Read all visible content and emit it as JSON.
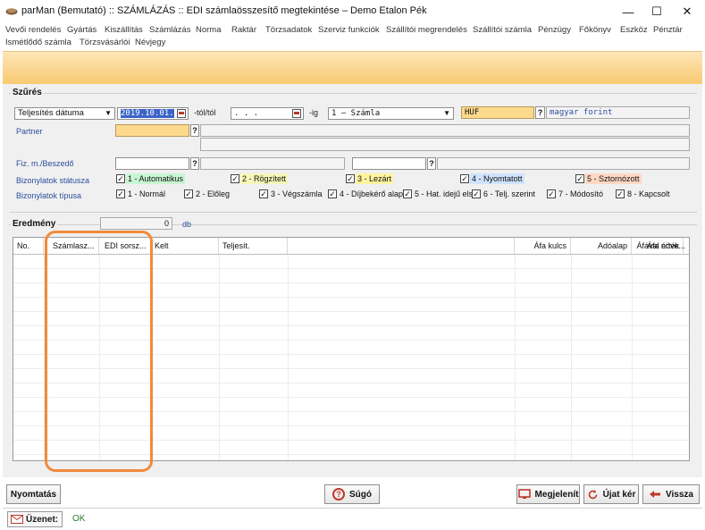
{
  "window": {
    "title": "parMan (Bemutató) :: SZÁMLÁZÁS :: EDI számlaösszesítő megtekintése   –   Demo Etalon Pék",
    "minimize": "—",
    "maximize": "☐",
    "close": "✕"
  },
  "menu": {
    "row1": [
      "Vevői rendelés",
      "Gyártás",
      "Kiszállítás",
      "Számlázás",
      "Norma",
      "Raktár",
      "Törzsadatok",
      "Szerviz funkciók",
      "Szállítói megrendelés",
      "Szállítói számla",
      "Pénzügy",
      "Főkönyv",
      "Eszköz",
      "Pénztár"
    ],
    "row2": [
      "Ismétlődő számla",
      "Törzsvásárlói",
      "Névjegy"
    ]
  },
  "filter": {
    "legend": "Szűrés",
    "date_type": "Teljesítés dátuma",
    "date_from": "2019.10.01.",
    "from_label": "-tól/tól",
    "date_to": "    .  .  .",
    "to_label": "-ig",
    "doc_type": "1 – Számla",
    "currency_code": "HUF",
    "currency_q": "?",
    "currency_name": "magyar forint",
    "partner_label": "Partner",
    "partner_q": "?",
    "payment_label": "Fiz. m./Beszedő",
    "payment_q": "?",
    "payment2_q": "?",
    "status_label": "Bizonylatok státusza",
    "type_label": "Bizonylatok típusa",
    "statuses": [
      {
        "label": "1 - Automatikus",
        "color": "#c8f5d2",
        "checked": "✓"
      },
      {
        "label": "2 - Rögzített",
        "color": "#f7f7b8",
        "checked": "✓"
      },
      {
        "label": "3 - Lezárt",
        "color": "#fff3a0",
        "checked": "✓"
      },
      {
        "label": "4 - Nyomtatott",
        "color": "#cfe3ff",
        "checked": "✓"
      },
      {
        "label": "5 - Sztornózott",
        "color": "#ffd8c4",
        "checked": "✓"
      }
    ],
    "types": [
      {
        "label": "1 - Normál",
        "checked": "✓"
      },
      {
        "label": "2 - Előleg",
        "checked": "✓"
      },
      {
        "label": "3 - Végszámla",
        "checked": "✓"
      },
      {
        "label": "4 - Díjbekérő alap",
        "checked": "✓"
      },
      {
        "label": "5 - Hat. idejű elsz",
        "checked": "✓"
      },
      {
        "label": "6 - Telj. szerint",
        "checked": "✓"
      },
      {
        "label": "7 - Módosító",
        "checked": "✓"
      },
      {
        "label": "8 - Kapcsolt",
        "checked": "✓"
      }
    ]
  },
  "result": {
    "legend": "Eredmény",
    "count": "0",
    "unit": "db",
    "columns": [
      "No.",
      "Számlasz...",
      "EDI sorsz...",
      "Kelt",
      "Teljesít.",
      "",
      "Áfa kulcs",
      "Adóalap",
      "Áfa érték",
      "Áfával növe..."
    ]
  },
  "buttons": {
    "print": "Nyomtatás",
    "help": "Súgó",
    "show": "Megjelenít",
    "new_query": "Újat kér",
    "back": "Vissza"
  },
  "status": {
    "label": "Üzenet:",
    "message": "OK"
  },
  "colors": {
    "banner": "#f8c96f",
    "selected": "#3b64c8",
    "highlight": "#f08a3c"
  }
}
